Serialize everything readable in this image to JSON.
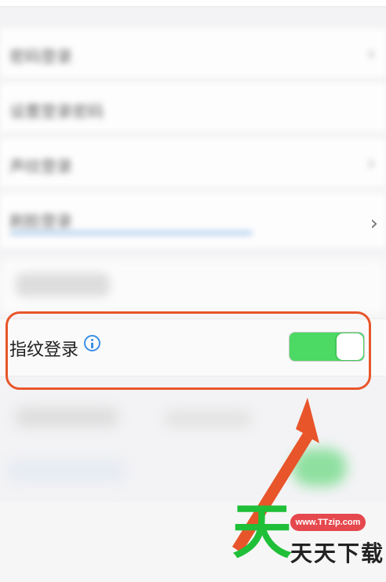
{
  "blurred_rows": [
    {
      "label": "密码登录"
    },
    {
      "label": "设置登录密码"
    },
    {
      "label": "声纹登录"
    },
    {
      "label": "刷脸登录"
    }
  ],
  "fingerprint_setting": {
    "label": "指纹登录",
    "toggle_on": true
  },
  "colors": {
    "toggle_on": "#4cd964",
    "highlight": "#e8552a",
    "info": "#3a8ee6"
  },
  "watermark": {
    "logo_char": "天",
    "url": "www.TTzip.com",
    "name": "天天下载"
  }
}
